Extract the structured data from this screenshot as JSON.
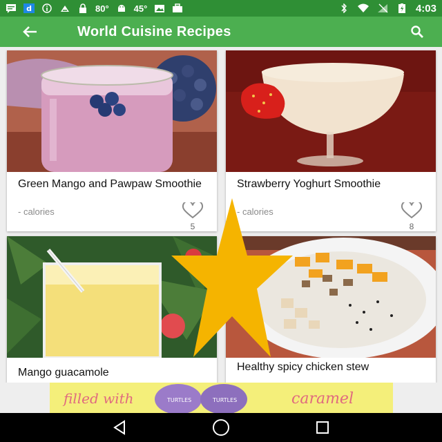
{
  "status_bar": {
    "temp1": "80°",
    "temp2": "45°",
    "time": "4:03"
  },
  "app_bar": {
    "title": "World Cuisine Recipes",
    "back_icon": "arrow-left-icon",
    "search_icon": "search-icon"
  },
  "recipes": [
    {
      "title": "Green Mango and Pawpaw Smoothie",
      "calories": "- calories",
      "likes": "5"
    },
    {
      "title": "Strawberry Yoghurt Smoothie",
      "calories": "- calories",
      "likes": "8"
    },
    {
      "title": "Mango guacamole"
    },
    {
      "title": "Healthy spicy chicken stew"
    }
  ],
  "ad": {
    "text_left": "filled with",
    "brand": "TURTLES",
    "text_right": "caramel"
  },
  "colors": {
    "status_bar": "#2f8f35",
    "app_bar": "#4caf50",
    "star": "#f5b400"
  }
}
